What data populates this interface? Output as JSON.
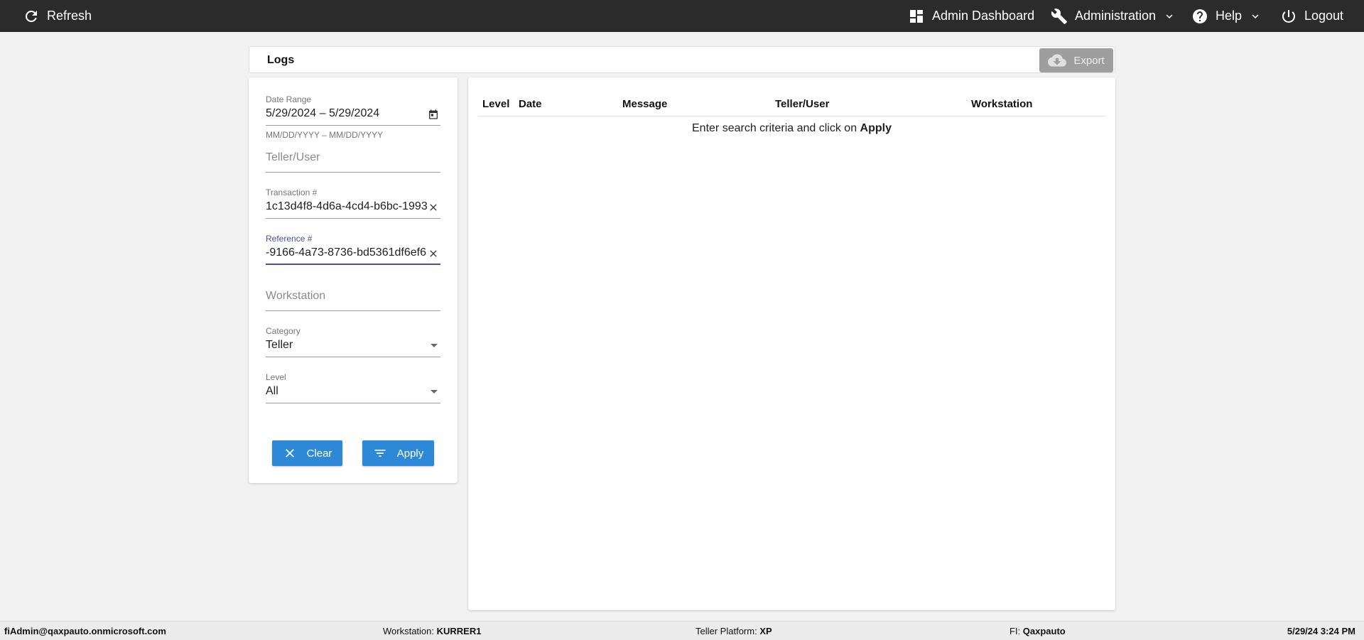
{
  "topbar": {
    "refresh": "Refresh",
    "admin_dashboard": "Admin Dashboard",
    "administration": "Administration",
    "help": "Help",
    "logout": "Logout"
  },
  "page": {
    "title": "Logs",
    "export": "Export"
  },
  "filters": {
    "date_range": {
      "label": "Date Range",
      "value": "5/29/2024 – 5/29/2024",
      "hint": "MM/DD/YYYY – MM/DD/YYYY"
    },
    "teller_user": {
      "placeholder": "Teller/User"
    },
    "transaction": {
      "label": "Transaction #",
      "value": "1c13d4f8-4d6a-4cd4-b6bc-1993"
    },
    "reference": {
      "label": "Reference #",
      "value": "-9166-4a73-8736-bd5361df6ef6"
    },
    "workstation": {
      "placeholder": "Workstation"
    },
    "category": {
      "label": "Category",
      "value": "Teller"
    },
    "level": {
      "label": "Level",
      "value": "All"
    },
    "clear": "Clear",
    "apply": "Apply"
  },
  "table": {
    "columns": [
      "Level",
      "Date",
      "Message",
      "Teller/User",
      "Workstation"
    ],
    "empty_prefix": "Enter search criteria and click on ",
    "empty_bold": "Apply"
  },
  "status": {
    "user": "fiAdmin@qaxpauto.onmicrosoft.com",
    "workstation_label": "Workstation: ",
    "workstation_value": "KURRER1",
    "platform_label": "Teller Platform: ",
    "platform_value": "XP",
    "fi_label": "FI: ",
    "fi_value": "Qaxpauto",
    "datetime": "5/29/24 3:24 PM"
  },
  "colors": {
    "topbar": "#2b2b2b",
    "primary_button": "#2d88d8",
    "active_field": "#3f51b5",
    "disabled_button": "#9e9e9e"
  }
}
